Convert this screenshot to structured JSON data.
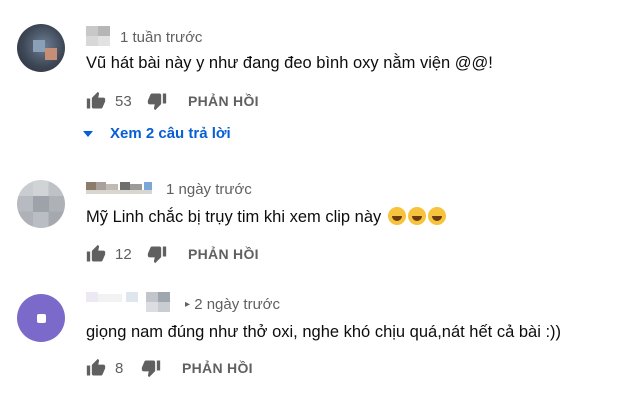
{
  "comments": [
    {
      "time": "1 tuần trước",
      "text": "Vũ hát bài này y như đang đeo bình oxy nằm viện @@!",
      "likes": "53",
      "reply_label": "PHẢN HỒI",
      "view_replies": "Xem 2 câu trả lời"
    },
    {
      "time": "1 ngày trước",
      "text": "Mỹ Linh chắc bị trụy tim khi xem clip này",
      "emojis": [
        "face-with-tears-of-joy",
        "face-with-tears-of-joy",
        "face-with-tears-of-joy"
      ],
      "likes": "12",
      "reply_label": "PHẢN HỒI"
    },
    {
      "time": "2 ngày trước",
      "text": "giọng nam đúng như thở oxi, nghe khó chịu quá,nát hết cả bài :))",
      "likes": "8",
      "reply_label": "PHẢN HỒI"
    }
  ],
  "colors": {
    "link": "#065fd4",
    "meta": "#606060",
    "text": "#0d0d0d",
    "avatar3": "#7c6acb"
  }
}
